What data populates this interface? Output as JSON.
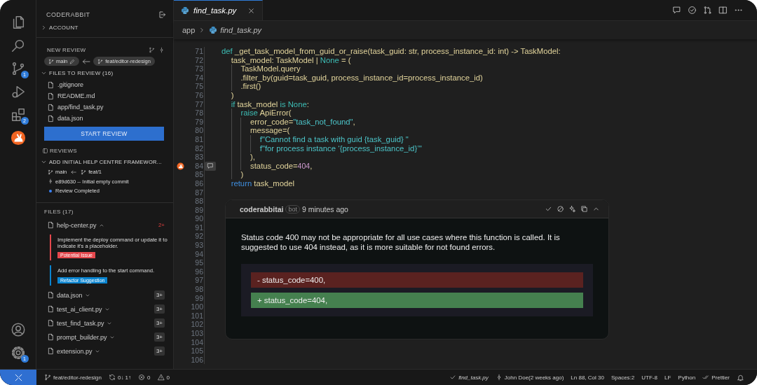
{
  "activity_bar": {
    "top": [
      {
        "kind": "explorer"
      },
      {
        "kind": "search"
      },
      {
        "kind": "source-control",
        "badge": "1"
      },
      {
        "kind": "run-debug"
      },
      {
        "kind": "extensions",
        "badge": "2"
      },
      {
        "kind": "coderabbit"
      }
    ],
    "bottom": [
      {
        "kind": "account"
      },
      {
        "kind": "settings",
        "badge": "1"
      }
    ]
  },
  "sidebar": {
    "title": "CODERABBIT",
    "account": {
      "label": "ACCOUNT",
      "expanded": false
    },
    "new_review": {
      "title": "NEW REVIEW",
      "base_branch": "main",
      "head_branch": "feat/editor-redesign",
      "files_to_review": {
        "label": "FILES TO REVIEW (16)",
        "expanded": true,
        "files": [
          ".gitignore",
          "README.md",
          "app/find_task.py",
          "data.json"
        ]
      },
      "button": "START REVIEW"
    },
    "reviews": {
      "title": "REVIEWS",
      "items": [
        {
          "title": "ADD INITIAL HELP CENTRE FRAMEWOR...",
          "expanded": true,
          "base_branch": "main",
          "head_branch": "feat/1",
          "commit": "e89d630 -- Initial empty commit",
          "status": "Review Completed"
        }
      ]
    },
    "files": {
      "title": "FILES (17)",
      "items": [
        {
          "name": "help-center.py",
          "expanded": true,
          "count": "2+",
          "kind": "flagged",
          "comments": [
            {
              "text": "Implement the deploy command or update it to indicate it's a placeholder.",
              "tag": "Potential Issue",
              "kind": "issue"
            },
            {
              "text": "Add error handling to the start command.",
              "tag": "Refactor Suggestion",
              "kind": "refactor"
            }
          ]
        },
        {
          "name": "data.json",
          "expanded": false,
          "count": "3+",
          "kind": "normal"
        },
        {
          "name": "test_ai_client.py",
          "expanded": false,
          "count": "3+",
          "kind": "normal"
        },
        {
          "name": "test_find_task.py",
          "expanded": false,
          "count": "3+",
          "kind": "normal"
        },
        {
          "name": "prompt_builder.py",
          "expanded": false,
          "count": "3+",
          "kind": "normal"
        },
        {
          "name": "extension.py",
          "expanded": false,
          "count": "3+",
          "kind": "normal"
        }
      ]
    }
  },
  "editor": {
    "tab": {
      "label": "find_task.py",
      "selected": true
    },
    "breadcrumbs": [
      {
        "kind": "folder",
        "text": "app"
      },
      {
        "kind": "file",
        "text": "find_task.py"
      }
    ],
    "lines": [
      {
        "n": "71",
        "comment_marker": false,
        "t": [
          {
            "kind": "keyword",
            "text": "def"
          },
          {
            "kind": "name",
            "text": " _get_task_model_from_guid_or_raise(task_guid: str, process_instance_id: int) -> TaskModel:"
          }
        ]
      },
      {
        "n": "72",
        "comment_marker": false,
        "t": [
          {
            "kind": "indent"
          },
          {
            "kind": "name",
            "text": "task_model: TaskModel | "
          },
          {
            "kind": "keyword",
            "text": "None"
          },
          {
            "kind": "name",
            "text": " = ("
          }
        ]
      },
      {
        "n": "73",
        "comment_marker": false,
        "t": [
          {
            "kind": "indent"
          },
          {
            "kind": "indent"
          },
          {
            "kind": "name",
            "text": "TaskModel.query"
          }
        ]
      },
      {
        "n": "74",
        "comment_marker": false,
        "t": [
          {
            "kind": "indent"
          },
          {
            "kind": "indent"
          },
          {
            "kind": "name",
            "text": ".filter_by(guid=task_guid, process_instance_id=process_instance_id)"
          }
        ]
      },
      {
        "n": "75",
        "comment_marker": false,
        "t": [
          {
            "kind": "indent"
          },
          {
            "kind": "indent"
          },
          {
            "kind": "name",
            "text": ".first()"
          }
        ]
      },
      {
        "n": "76",
        "comment_marker": false,
        "t": [
          {
            "kind": "indent"
          },
          {
            "kind": "name",
            "text": ")"
          }
        ]
      },
      {
        "n": "77",
        "comment_marker": false,
        "t": [
          {
            "kind": "indent"
          },
          {
            "kind": "keyword",
            "text": "if"
          },
          {
            "kind": "name",
            "text": " task_model "
          },
          {
            "kind": "keyword",
            "text": "is None"
          },
          {
            "kind": "name",
            "text": ":"
          }
        ]
      },
      {
        "n": "78",
        "comment_marker": false,
        "t": [
          {
            "kind": "indent"
          },
          {
            "kind": "indent"
          },
          {
            "kind": "keyword",
            "text": "raise"
          },
          {
            "kind": "name",
            "text": " ApiError("
          }
        ]
      },
      {
        "n": "79",
        "comment_marker": false,
        "t": [
          {
            "kind": "indent"
          },
          {
            "kind": "indent"
          },
          {
            "kind": "indent"
          },
          {
            "kind": "name",
            "text": "error_code="
          },
          {
            "kind": "string",
            "text": "\"task_not_found\""
          },
          {
            "kind": "name",
            "text": ","
          }
        ]
      },
      {
        "n": "80",
        "comment_marker": false,
        "t": [
          {
            "kind": "indent"
          },
          {
            "kind": "indent"
          },
          {
            "kind": "indent"
          },
          {
            "kind": "name",
            "text": "message=("
          }
        ]
      },
      {
        "n": "81",
        "comment_marker": false,
        "t": [
          {
            "kind": "indent"
          },
          {
            "kind": "indent"
          },
          {
            "kind": "indent"
          },
          {
            "kind": "indent"
          },
          {
            "kind": "string",
            "text": "f\"Cannot find a task with guid {task_guid} \""
          }
        ]
      },
      {
        "n": "82",
        "comment_marker": false,
        "t": [
          {
            "kind": "indent"
          },
          {
            "kind": "indent"
          },
          {
            "kind": "indent"
          },
          {
            "kind": "indent"
          },
          {
            "kind": "string",
            "text": "f\"for process instance ‘{process_instance_id}’\""
          }
        ]
      },
      {
        "n": "83",
        "comment_marker": false,
        "t": [
          {
            "kind": "indent"
          },
          {
            "kind": "indent"
          },
          {
            "kind": "indent"
          },
          {
            "kind": "name",
            "text": "),"
          }
        ]
      },
      {
        "n": "84",
        "comment_marker": true,
        "t": [
          {
            "kind": "indent"
          },
          {
            "kind": "indent"
          },
          {
            "kind": "indent"
          },
          {
            "kind": "name",
            "text": "status_code="
          },
          {
            "kind": "number",
            "text": "404"
          },
          {
            "kind": "name",
            "text": ","
          }
        ]
      },
      {
        "n": "85",
        "comment_marker": false,
        "t": [
          {
            "kind": "indent"
          },
          {
            "kind": "indent"
          },
          {
            "kind": "name",
            "text": ")"
          }
        ]
      },
      {
        "n": "86",
        "comment_marker": false,
        "t": [
          {
            "kind": "indent"
          },
          {
            "kind": "return",
            "text": "return"
          },
          {
            "kind": "name",
            "text": " task_model"
          }
        ]
      },
      {
        "n": "87",
        "comment_marker": false
      },
      {
        "n": "88",
        "comment_marker": false
      },
      {
        "n": "89",
        "comment_marker": false
      },
      {
        "n": "90",
        "comment_marker": false
      },
      {
        "n": "91",
        "comment_marker": false
      },
      {
        "n": "92",
        "comment_marker": false
      },
      {
        "n": "93",
        "comment_marker": false
      },
      {
        "n": "94",
        "comment_marker": false
      },
      {
        "n": "95",
        "comment_marker": false
      },
      {
        "n": "96",
        "comment_marker": false
      },
      {
        "n": "97",
        "comment_marker": false
      },
      {
        "n": "98",
        "comment_marker": false
      },
      {
        "n": "99",
        "comment_marker": false
      },
      {
        "n": "100",
        "comment_marker": false
      },
      {
        "n": "101",
        "comment_marker": false
      },
      {
        "n": "102",
        "comment_marker": false
      },
      {
        "n": "103",
        "comment_marker": false
      },
      {
        "n": "104",
        "comment_marker": false
      },
      {
        "n": "105",
        "comment_marker": false
      },
      {
        "n": "106",
        "comment_marker": false
      }
    ],
    "comment": {
      "author": "coderabbitai",
      "badge": "bot",
      "time": "9 minutes ago",
      "body": "Status code 400 may not be appropriate for all use cases where this function is called. It is suggested to use 404 instead, as it is more suitable for not found errors.",
      "diff": [
        {
          "kind": "removed",
          "text": "- status_code=400,"
        },
        {
          "kind": "added",
          "text": "+ status_code=404,"
        }
      ]
    }
  },
  "status_bar": {
    "left": [
      {
        "kind": "remote"
      },
      {
        "kind": "branch",
        "text": "feat/editor-redesign"
      },
      {
        "kind": "sync",
        "text": "0↓ 1↑"
      },
      {
        "kind": "errors",
        "text": "0"
      },
      {
        "kind": "warnings",
        "text": "0"
      }
    ],
    "right": [
      {
        "kind": "check",
        "text": "find_task.py"
      },
      {
        "kind": "commit",
        "text": "John Doe(2 weeks ago)"
      },
      {
        "kind": "plain",
        "text": "Ln 88, Col 30"
      },
      {
        "kind": "plain",
        "text": "Spaces:2"
      },
      {
        "kind": "plain",
        "text": "UTF-8"
      },
      {
        "kind": "plain",
        "text": "LF"
      },
      {
        "kind": "plain",
        "text": "Python"
      },
      {
        "kind": "prettier",
        "text": "Prettier"
      },
      {
        "kind": "bell"
      }
    ]
  }
}
